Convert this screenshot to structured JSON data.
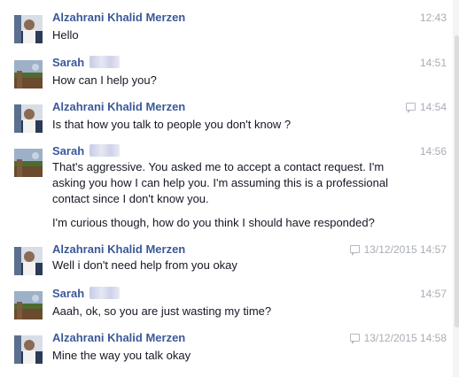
{
  "messages": [
    {
      "sender": "Alzahrani Khalid Merzen",
      "time": "12:43",
      "seen": false,
      "text": [
        "Hello"
      ]
    },
    {
      "sender": "Sarah",
      "time": "14:51",
      "seen": false,
      "text": [
        "How can I help you?"
      ]
    },
    {
      "sender": "Alzahrani Khalid Merzen",
      "time": "14:54",
      "seen": true,
      "text": [
        "Is that how you talk to people you don't know ?"
      ]
    },
    {
      "sender": "Sarah",
      "time": "14:56",
      "seen": false,
      "text": [
        "That's aggressive. You asked me to accept a contact request. I'm asking you how I can help you. I'm assuming this is a professional contact since I don't know you.",
        "I'm curious though, how do you think I should have responded?"
      ]
    },
    {
      "sender": "Alzahrani Khalid Merzen",
      "time": "13/12/2015 14:57",
      "seen": true,
      "text": [
        "Well i don't need help from you okay"
      ]
    },
    {
      "sender": "Sarah",
      "time": "14:57",
      "seen": false,
      "text": [
        "Aaah, ok, so you are just wasting my time?"
      ]
    },
    {
      "sender": "Alzahrani Khalid Merzen",
      "time": "13/12/2015 14:58",
      "seen": true,
      "text": [
        "Mine the way you talk okay"
      ]
    }
  ],
  "colors": {
    "name": "#3b5998",
    "text": "#141823",
    "time": "#a8adb6"
  },
  "icons": {
    "seen": "seen-check-icon"
  }
}
